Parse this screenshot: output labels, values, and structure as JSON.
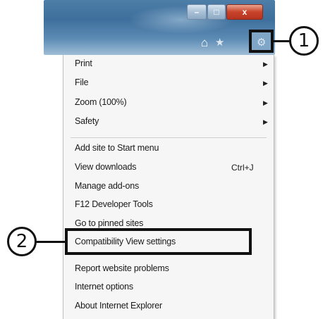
{
  "window": {
    "minimize_glyph": "–",
    "maximize_glyph": "□",
    "close_glyph": "x"
  },
  "toolbar": {
    "home_icon": "home-icon",
    "favorites_icon": "star-icon",
    "tools_icon": "gear-icon"
  },
  "callouts": {
    "one": "1",
    "two": "2"
  },
  "menu": {
    "items": [
      {
        "label": "Print",
        "submenu": true
      },
      {
        "label": "File",
        "submenu": true
      },
      {
        "label": "Zoom (100%)",
        "submenu": true
      },
      {
        "label": "Safety",
        "submenu": true
      },
      {
        "label": "Add site to Start menu"
      },
      {
        "label": "View downloads",
        "shortcut": "Ctrl+J"
      },
      {
        "label": "Manage add-ons"
      },
      {
        "label": "F12 Developer Tools"
      },
      {
        "label": "Go to pinned sites"
      },
      {
        "label": "Compatibility View settings"
      },
      {
        "label": "Report website problems"
      },
      {
        "label": "Internet options"
      },
      {
        "label": "About Internet Explorer"
      }
    ]
  }
}
